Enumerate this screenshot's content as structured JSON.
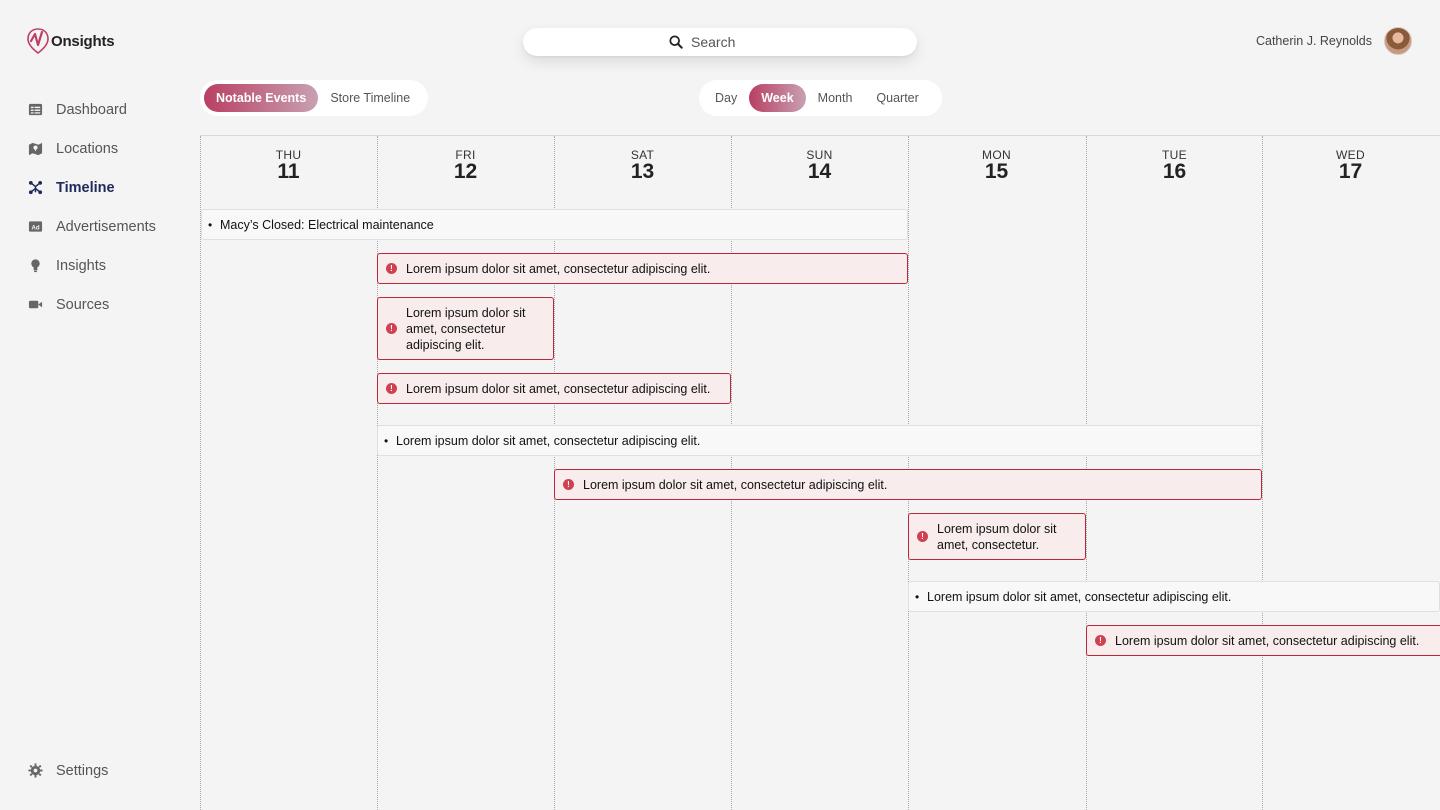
{
  "app": {
    "name": "Onsights"
  },
  "search": {
    "placeholder": "Search"
  },
  "user": {
    "name": "Catherin J. Reynolds"
  },
  "sidebar": {
    "items": [
      {
        "label": "Dashboard",
        "icon": "table-icon"
      },
      {
        "label": "Locations",
        "icon": "map-icon"
      },
      {
        "label": "Timeline",
        "icon": "timeline-icon",
        "active": true
      },
      {
        "label": "Advertisements",
        "icon": "ad-icon"
      },
      {
        "label": "Insights",
        "icon": "lightbulb-icon"
      },
      {
        "label": "Sources",
        "icon": "video-camera-icon"
      }
    ],
    "settings_label": "Settings"
  },
  "view_toggle": {
    "options": [
      "Notable Events",
      "Store Timeline"
    ],
    "selected": "Notable Events"
  },
  "range_toggle": {
    "options": [
      "Day",
      "Week",
      "Month",
      "Quarter"
    ],
    "selected": "Week"
  },
  "calendar": {
    "days": [
      {
        "name": "THU",
        "num": "11"
      },
      {
        "name": "FRI",
        "num": "12"
      },
      {
        "name": "SAT",
        "num": "13"
      },
      {
        "name": "SUN",
        "num": "14"
      },
      {
        "name": "MON",
        "num": "15"
      },
      {
        "name": "TUE",
        "num": "16"
      },
      {
        "name": "WED",
        "num": "17"
      }
    ],
    "events": [
      {
        "type": "note",
        "text": "Macy’s Closed: Electrical maintenance",
        "start_day": "THU 11",
        "end_day": "SUN 14"
      },
      {
        "type": "alert",
        "text": "Lorem ipsum dolor sit amet, consectetur adipiscing elit.",
        "start_day": "FRI 12",
        "end_day": "SUN 14"
      },
      {
        "type": "alert",
        "text": "Lorem ipsum dolor sit amet, consectetur adipiscing elit.",
        "start_day": "FRI 12",
        "end_day": "FRI 12"
      },
      {
        "type": "alert",
        "text": "Lorem ipsum dolor sit amet, consectetur adipiscing elit.",
        "start_day": "FRI 12",
        "end_day": "SAT 13"
      },
      {
        "type": "note",
        "text": "Lorem ipsum dolor sit amet, consectetur adipiscing elit.",
        "start_day": "FRI 12",
        "end_day": "TUE 16"
      },
      {
        "type": "alert",
        "text": "Lorem ipsum dolor sit amet, consectetur adipiscing elit.",
        "start_day": "SAT 13",
        "end_day": "TUE 16"
      },
      {
        "type": "alert",
        "text": "Lorem ipsum dolor sit amet, consectetur.",
        "start_day": "MON 15",
        "end_day": "MON 15"
      },
      {
        "type": "note",
        "text": "Lorem ipsum dolor sit amet, consectetur adipiscing elit.",
        "start_day": "MON 15",
        "end_day": "WED 17"
      },
      {
        "type": "alert",
        "text": "Lorem ipsum dolor sit amet, consectetur adipiscing elit.",
        "start_day": "TUE 16",
        "end_day": "WED 17"
      }
    ]
  },
  "colors": {
    "accent": "#b84062",
    "alert_border": "#b8283a",
    "alert_bg": "#f8ecec",
    "active_nav": "#1f2a5a"
  }
}
